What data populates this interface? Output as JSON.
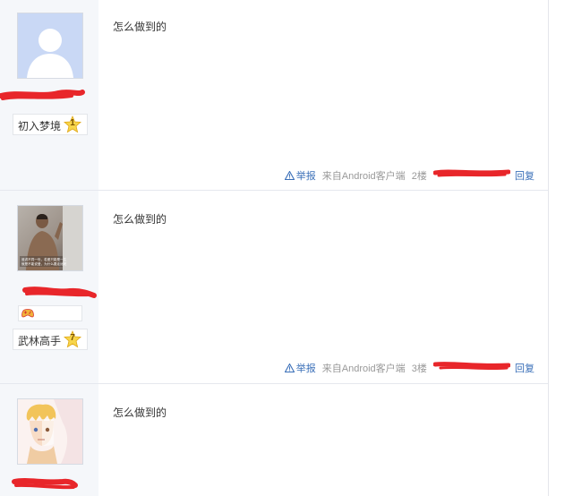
{
  "posts": [
    {
      "level_title": "初入梦境",
      "level_num": "1",
      "content": "怎么做到的",
      "report_label": "举报",
      "source": "来自Android客户端",
      "floor": "2楼",
      "reply_label": "回复"
    },
    {
      "level_title": "武林高手",
      "level_num": "7",
      "content": "怎么做到的",
      "report_label": "举报",
      "source": "来自Android客户端",
      "floor": "3楼",
      "reply_label": "回复",
      "photo_caption_1": "谁说不同一世，若爱只能是一生",
      "photo_caption_2": "就是不能说爱，为什么要走远呢"
    },
    {
      "content": "怎么做到的"
    }
  ],
  "colors": {
    "link": "#3a6fb8",
    "muted": "#999999",
    "redact": "#e8262a",
    "sidebar": "#f5f7fa"
  },
  "icons": {
    "report": "warning-triangle-icon",
    "level": "star-badge-icon",
    "game": "gamepad-icon",
    "default_avatar": "person-silhouette-icon"
  }
}
